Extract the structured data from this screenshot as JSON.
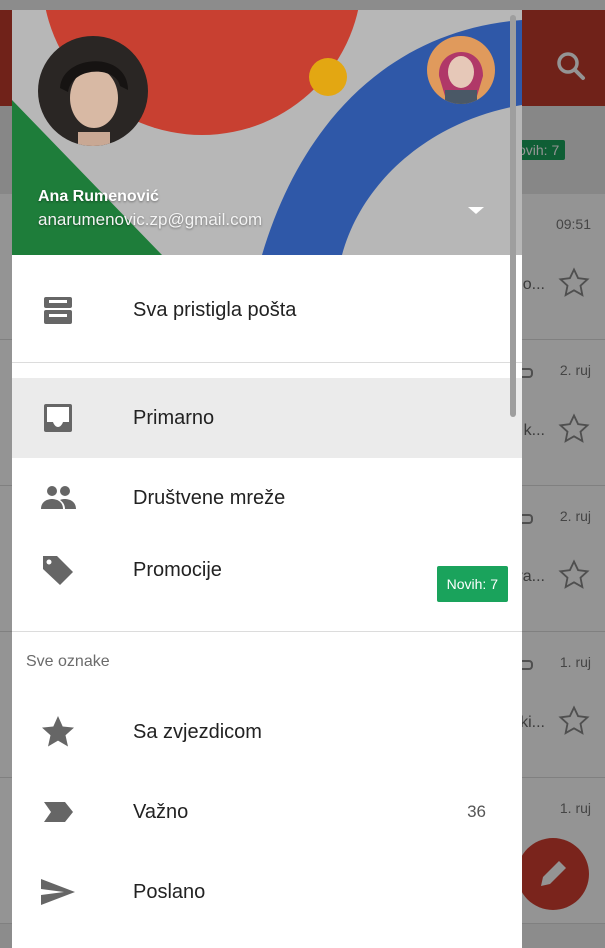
{
  "background_inbox": {
    "new_badge": "ovih: 7",
    "rows": [
      {
        "date": "09:51",
        "snippet": "no..."
      },
      {
        "date": "2. ruj",
        "snippet": "k..."
      },
      {
        "date": "2. ruj",
        "snippet": "ra..."
      },
      {
        "date": "1. ruj",
        "snippet": "ki..."
      },
      {
        "date": "1. ruj",
        "snippet": ""
      }
    ]
  },
  "account": {
    "name": "Ana Rumenović",
    "email": "anarumenovic.zp@gmail.com"
  },
  "drawer": {
    "items": [
      {
        "label": "Sva pristigla pošta",
        "icon": "all-inboxes-icon"
      },
      {
        "label": "Primarno",
        "icon": "inbox-icon",
        "selected": true
      },
      {
        "label": "Društvene mreže",
        "icon": "people-icon"
      },
      {
        "label": "Promocije",
        "icon": "tag-icon",
        "badge": "Novih: 7"
      },
      {
        "label": "Sa zvjezdicom",
        "icon": "star-icon"
      },
      {
        "label": "Važno",
        "icon": "important-icon",
        "count": "36"
      },
      {
        "label": "Poslano",
        "icon": "send-icon"
      }
    ],
    "section_label": "Sve oznake"
  },
  "colors": {
    "gmail_red": "#c23b2c",
    "badge_green": "#1aa35c",
    "header_green": "#1e7d3a",
    "header_blue": "#2f58a8",
    "header_red": "#c84031",
    "header_yellow": "#e3a712"
  }
}
